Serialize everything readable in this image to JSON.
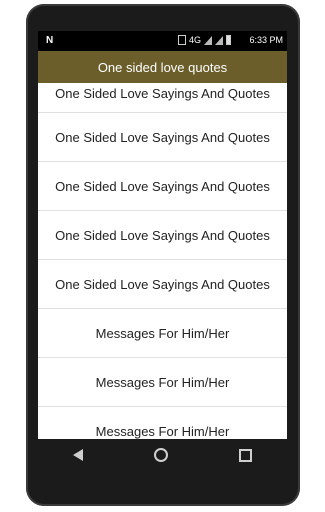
{
  "status": {
    "time": "6:33",
    "ampm": "PM",
    "network": "4G"
  },
  "app": {
    "title": "One sided love quotes"
  },
  "items": [
    "One Sided Love Sayings And Quotes",
    "One Sided Love Sayings And Quotes",
    "One Sided Love Sayings And Quotes",
    "One Sided Love Sayings And Quotes",
    "One Sided Love Sayings And Quotes",
    "Messages For Him/Her",
    "Messages For Him/Her",
    "Messages For Him/Her"
  ],
  "navbar": {
    "back_icon": "back-icon",
    "home_icon": "home-icon",
    "recent_icon": "recent-apps-icon"
  }
}
